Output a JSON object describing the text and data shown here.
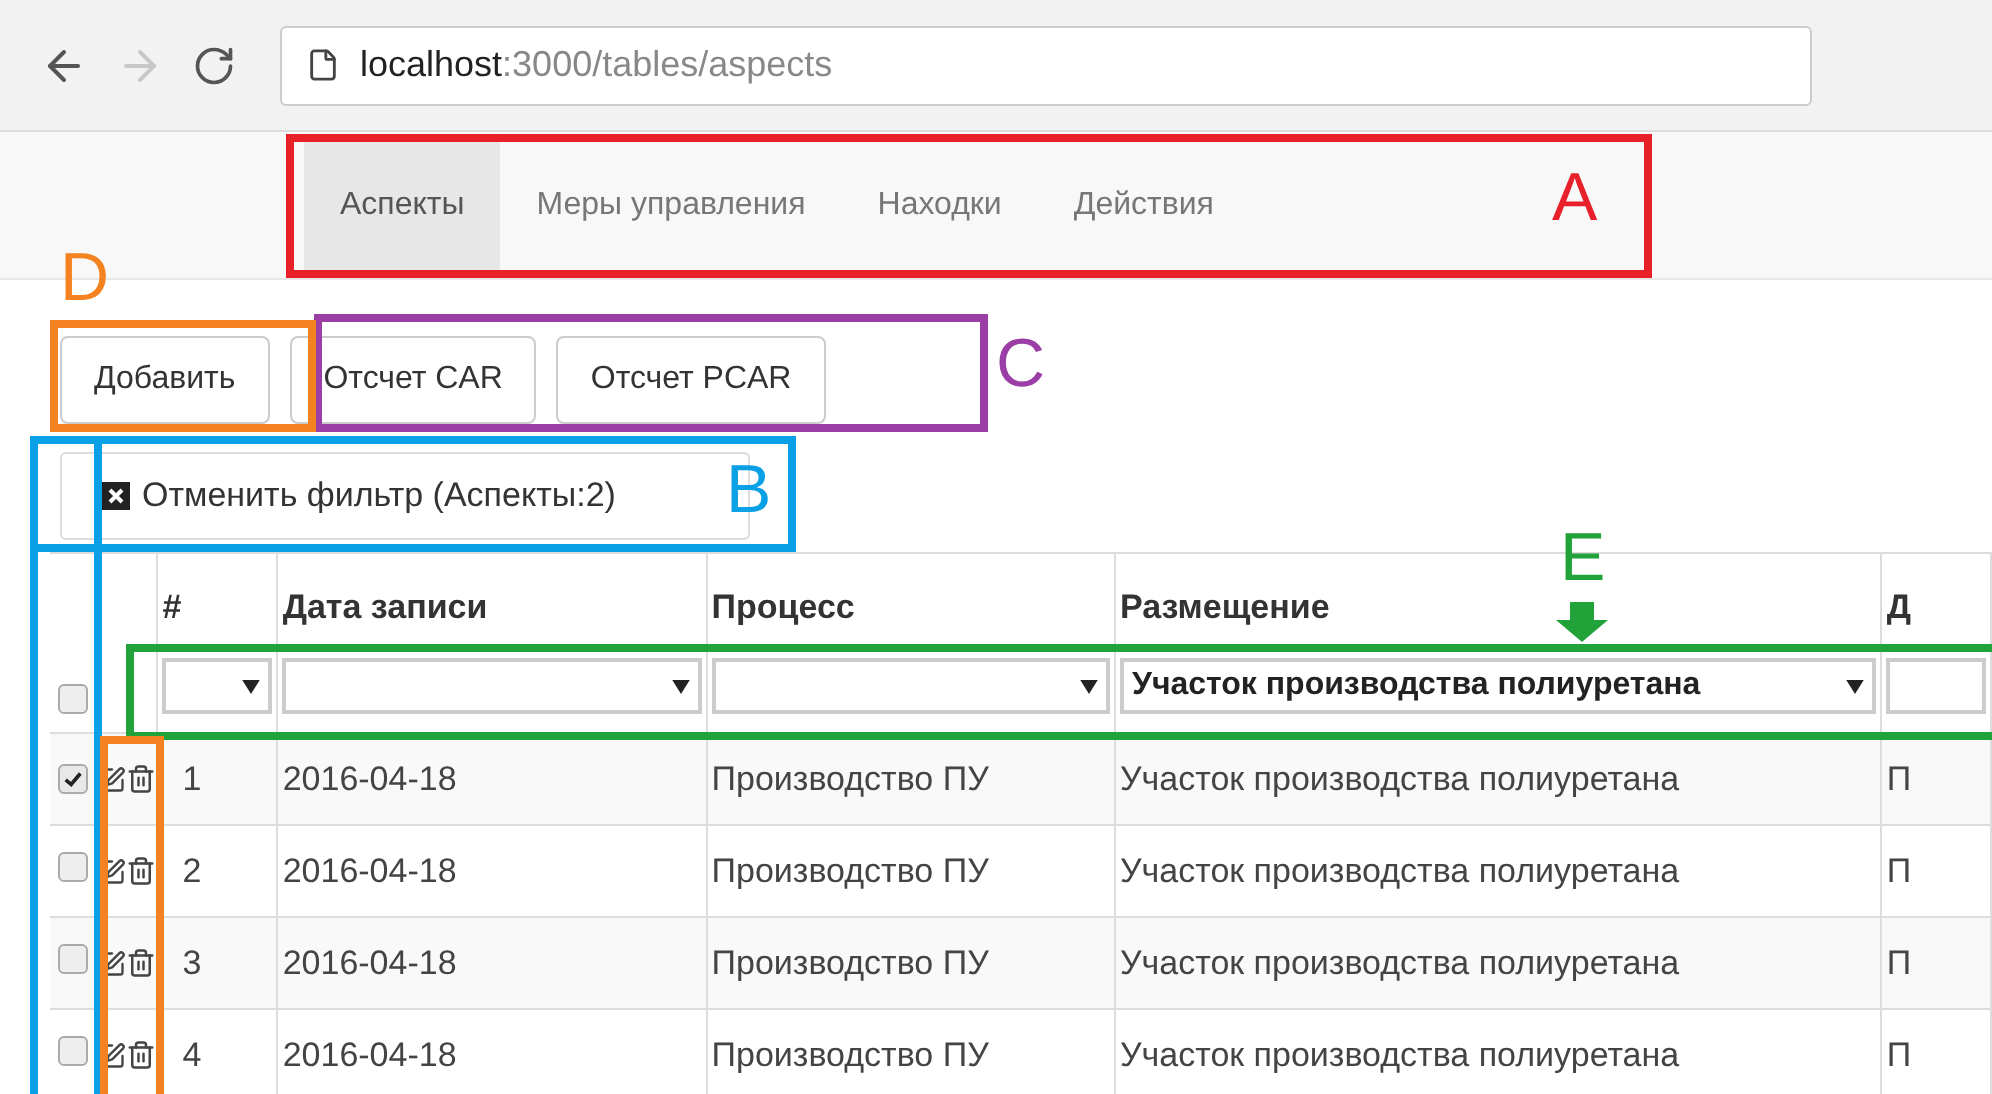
{
  "browser": {
    "url_host": "localhost",
    "url_path": ":3000/tables/aspects"
  },
  "nav_tabs": [
    {
      "label": "Аспекты",
      "selected": true
    },
    {
      "label": "Меры управления",
      "selected": false
    },
    {
      "label": "Находки",
      "selected": false
    },
    {
      "label": "Действия",
      "selected": false
    }
  ],
  "buttons": [
    "Добавить",
    "Отсчет CAR",
    "Отсчет PCAR"
  ],
  "filter_reset": {
    "label": "Отменить фильтр (Аспекты:2)"
  },
  "table": {
    "select_all_checked": false,
    "columns": [
      {
        "title": "#"
      },
      {
        "title": "Дата записи"
      },
      {
        "title": "Процесс"
      },
      {
        "title": "Размещение",
        "filter": "Участок производства полиуретана"
      },
      {
        "title": "Д"
      }
    ],
    "rows": [
      {
        "checked": true,
        "cells": [
          "1",
          "2016-04-18",
          "Производство ПУ",
          "Участок производства полиуретана",
          "П"
        ]
      },
      {
        "checked": false,
        "cells": [
          "2",
          "2016-04-18",
          "Производство ПУ",
          "Участок производства полиуретана",
          "П"
        ]
      },
      {
        "checked": false,
        "cells": [
          "3",
          "2016-04-18",
          "Производство ПУ",
          "Участок производства полиуретана",
          "П"
        ]
      },
      {
        "checked": false,
        "cells": [
          "4",
          "2016-04-18",
          "Производство ПУ",
          "Участок производства полиуретана",
          "П"
        ]
      }
    ]
  },
  "annotations": [
    {
      "label": "A",
      "color": "#e8202a"
    },
    {
      "label": "B",
      "color": "#0aa0e6"
    },
    {
      "label": "C",
      "color": "#9b3fa6"
    },
    {
      "label": "D",
      "color": "#f58220"
    },
    {
      "label": "E",
      "color": "#22a33a"
    }
  ]
}
